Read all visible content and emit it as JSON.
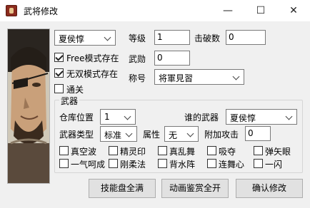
{
  "window": {
    "title": "武将修改",
    "minimize": "—",
    "maximize": "☐",
    "close": "✕"
  },
  "general": {
    "selected": "夏侯惇"
  },
  "level": {
    "label": "等级",
    "value": "1"
  },
  "kills": {
    "label": "击破数",
    "value": "0"
  },
  "merit": {
    "label": "武勋",
    "value": "0"
  },
  "title_field": {
    "label": "称号",
    "selected": "将軍見習"
  },
  "checks": {
    "free_mode": {
      "label": "Free模式存在",
      "checked": true
    },
    "musou_mode": {
      "label": "无双模式存在",
      "checked": true
    },
    "cleared": {
      "label": "通关",
      "checked": false
    }
  },
  "weapon": {
    "group_title": "武器",
    "slot_label": "仓库位置",
    "slot_value": "1",
    "owner_label": "谁的武器",
    "owner_value": "夏侯惇",
    "type_label": "武器类型",
    "type_value": "标准",
    "attr_label": "属性",
    "attr_value": "无",
    "atk_label": "附加攻击",
    "atk_value": "0",
    "skills_row1": [
      "真空波",
      "精灵印",
      "真乱舞",
      "吸夺",
      "弹矢眼"
    ],
    "skills_row2": [
      "一气呵成",
      "刚柔法",
      "背水阵",
      "连舞心",
      "一闪"
    ]
  },
  "buttons": {
    "skills_full": "技能盘全满",
    "anim_full": "动画鉴赏全开",
    "confirm": "确认修改"
  }
}
